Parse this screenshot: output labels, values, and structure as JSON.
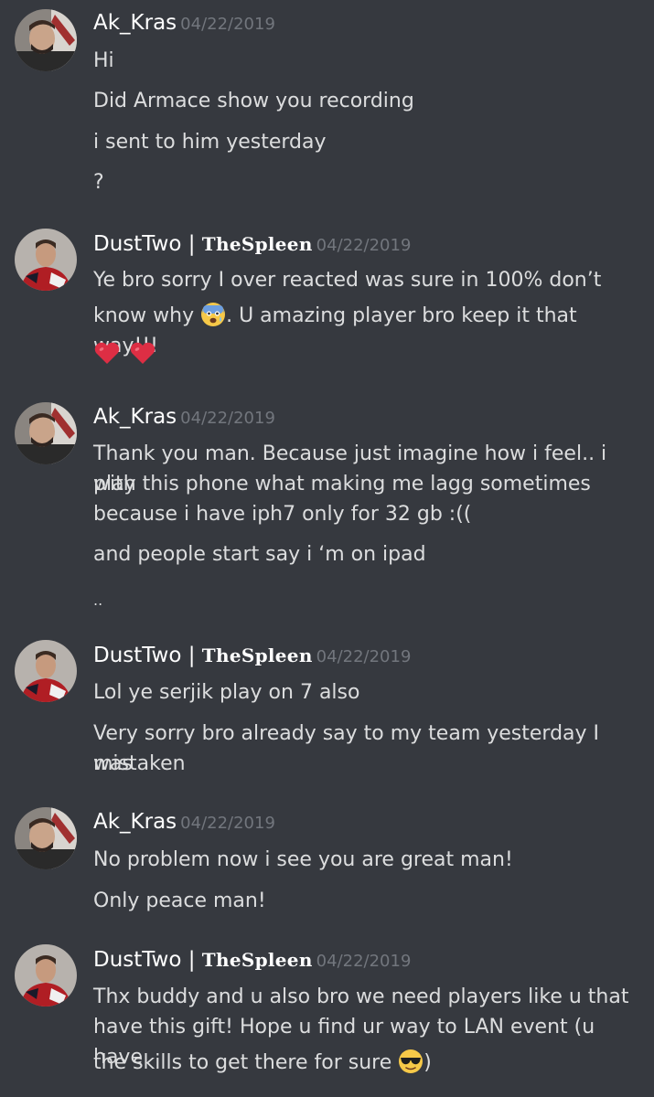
{
  "users": {
    "ak": {
      "name": "Ak_Kras"
    },
    "dust": {
      "name_prefix": "DustTwo | ",
      "name_fancy": "TheSpleen"
    }
  },
  "messages": [
    {
      "author": "ak",
      "timestamp": "04/22/2019",
      "lines": [
        "Hi",
        "Did Armace show you recording",
        "i sent to him yesterday",
        "?"
      ]
    },
    {
      "author": "dust",
      "timestamp": "04/22/2019",
      "line1a": "Ye bro sorry I over reacted was sure in 100% don’t",
      "line2a": "know why ",
      "line2b": ". U amazing player bro keep it that way!!!",
      "emojis": [
        "fearful-face-emoji",
        "red-heart-emoji",
        "red-heart-emoji"
      ]
    },
    {
      "author": "ak",
      "timestamp": "04/22/2019",
      "lines": [
        "Thank you man. Because just imagine how i feel.. i play",
        "with this phone what making me lagg sometimes",
        "because i have iph7 only for 32 gb :((",
        "and people start say i ‘m on ipad",
        ".."
      ]
    },
    {
      "author": "dust",
      "timestamp": "04/22/2019",
      "lines": [
        "Lol ye serjik play on 7 also",
        "Very sorry bro already say to my team yesterday I was",
        "mistaken"
      ]
    },
    {
      "author": "ak",
      "timestamp": "04/22/2019",
      "lines": [
        "No problem now i see you are great man!",
        "Only peace man!"
      ]
    },
    {
      "author": "dust",
      "timestamp": "04/22/2019",
      "lines": [
        "Thx buddy and u also bro we need players like u that",
        "have this gift! Hope u find ur way to LAN event (u have"
      ],
      "last_a": "the skills to get there for sure ",
      "last_b": ")",
      "emojis": [
        "sunglasses-emoji"
      ]
    }
  ]
}
